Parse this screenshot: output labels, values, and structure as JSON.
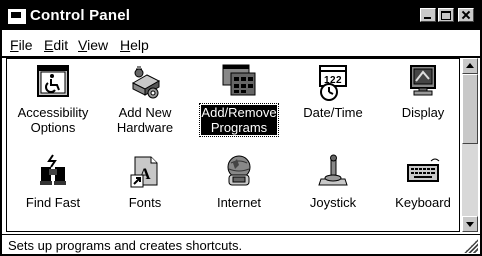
{
  "window": {
    "title": "Control Panel"
  },
  "menu": [
    {
      "label": "File"
    },
    {
      "label": "Edit"
    },
    {
      "label": "View"
    },
    {
      "label": "Help"
    }
  ],
  "items": [
    {
      "label": "Accessibility Options",
      "icon": "accessibility-icon"
    },
    {
      "label": "Add New Hardware",
      "icon": "hardware-icon"
    },
    {
      "label": "Add/Remove Programs",
      "icon": "programs-icon",
      "selected": true
    },
    {
      "label": "Date/Time",
      "icon": "datetime-icon"
    },
    {
      "label": "Display",
      "icon": "display-icon"
    },
    {
      "label": "Find Fast",
      "icon": "binoculars-icon"
    },
    {
      "label": "Fonts",
      "icon": "fonts-icon"
    },
    {
      "label": "Internet",
      "icon": "internet-icon"
    },
    {
      "label": "Joystick",
      "icon": "joystick-icon"
    },
    {
      "label": "Keyboard",
      "icon": "keyboard-icon"
    }
  ],
  "status": {
    "text": "Sets up programs and creates shortcuts."
  }
}
